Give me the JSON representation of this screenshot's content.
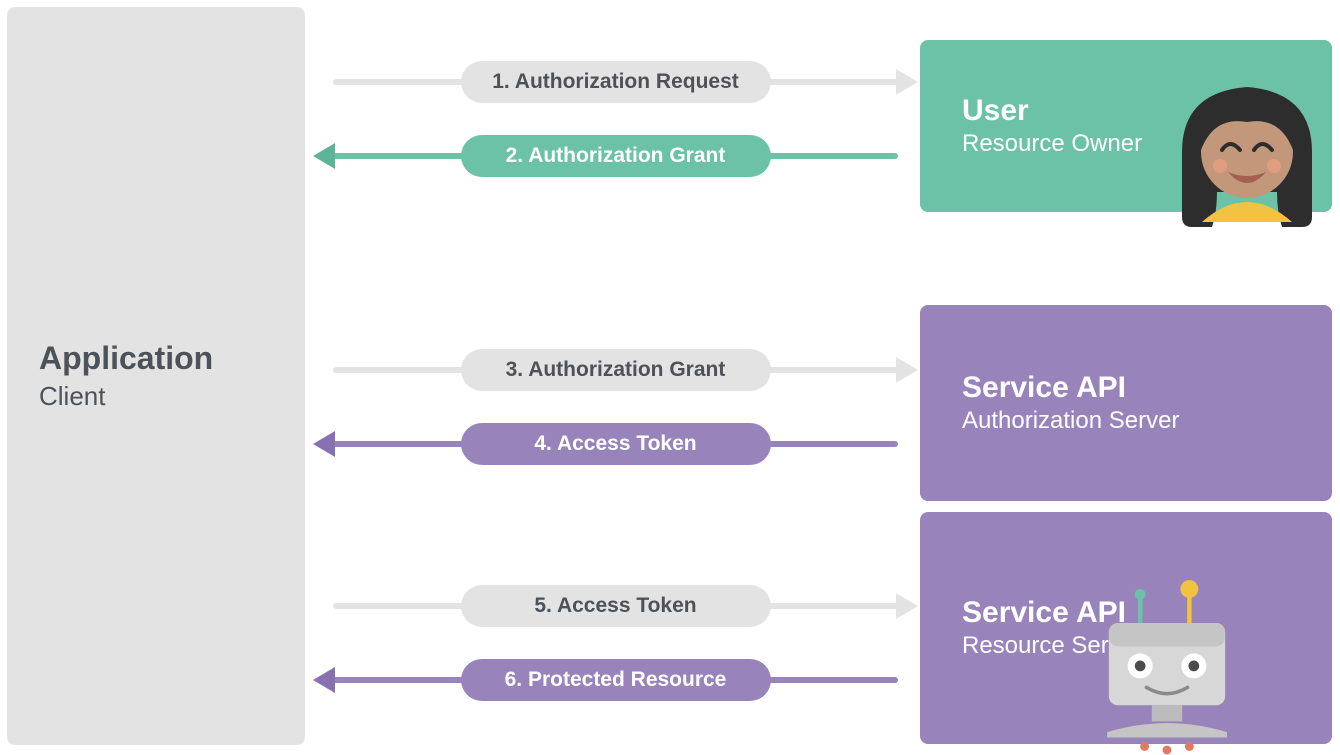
{
  "client": {
    "title": "Application",
    "subtitle": "Client"
  },
  "user": {
    "title": "User",
    "subtitle": "Resource Owner"
  },
  "auth": {
    "title": "Service API",
    "subtitle": "Authorization Server"
  },
  "resource": {
    "title": "Service API",
    "subtitle": "Resource Server"
  },
  "flows": {
    "f1": "1. Authorization Request",
    "f2": "2. Authorization Grant",
    "f3": "3. Authorization Grant",
    "f4": "4. Access Token",
    "f5": "5. Access Token",
    "f6": "6. Protected Resource"
  },
  "colors": {
    "teal": "#6bc2a7",
    "purple": "#9883bb",
    "grey": "#e3e3e3"
  }
}
